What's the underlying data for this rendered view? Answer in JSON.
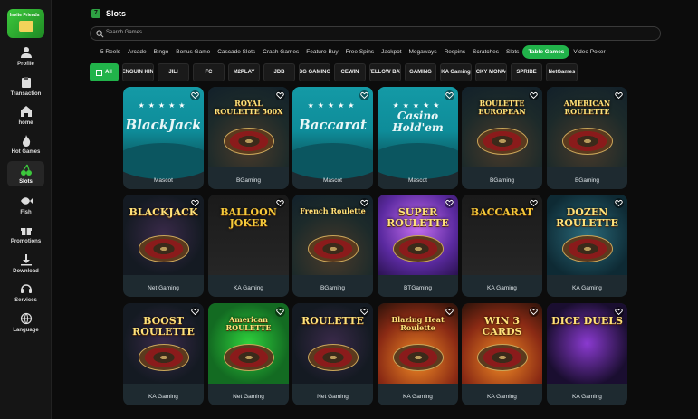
{
  "promo": {
    "label": "Invite Friends"
  },
  "sidebar": {
    "items": [
      {
        "label": "Profile",
        "icon": "user-icon"
      },
      {
        "label": "Transaction",
        "icon": "clipboard-icon"
      },
      {
        "label": "home",
        "icon": "home-icon"
      },
      {
        "label": "Hot Games",
        "icon": "flame-icon"
      },
      {
        "label": "Slots",
        "icon": "cherry-icon",
        "active": true
      },
      {
        "label": "Fish",
        "icon": "fish-icon"
      },
      {
        "label": "Promotions",
        "icon": "gift-icon"
      },
      {
        "label": "Download",
        "icon": "download-icon"
      },
      {
        "label": "Services",
        "icon": "headset-icon"
      },
      {
        "label": "Language",
        "icon": "globe-icon"
      }
    ]
  },
  "header": {
    "badge": "7",
    "title": "Slots"
  },
  "search": {
    "placeholder": "Search Games"
  },
  "categories": [
    "5 Reels",
    "Arcade",
    "Bingo",
    "Bonus Game",
    "Cascade Slots",
    "Crash Games",
    "Feature Buy",
    "Free Spins",
    "Jackpot",
    "Megaways",
    "Respins",
    "Scratches",
    "Slots",
    "Table Games",
    "Video Poker"
  ],
  "active_category": "Table Games",
  "providers": [
    "All",
    "PENGUIN KING",
    "JILI",
    "FC",
    "M2PLAY",
    "JDB",
    "BG GAMING",
    "CEWIN",
    "YELLOW BAT",
    "GAMING",
    "KA Gaming",
    "LUCKY MONACO",
    "SPRIBE",
    "NetGames"
  ],
  "games": [
    {
      "title": "BlackJack",
      "provider": "Mascot",
      "style": "teal"
    },
    {
      "title": "ROYAL ROULETTE 500X",
      "provider": "BGaming",
      "style": "roul"
    },
    {
      "title": "Baccarat",
      "provider": "Mascot",
      "style": "teal"
    },
    {
      "title": "Casino Hold'em",
      "provider": "Mascot",
      "style": "teal"
    },
    {
      "title": "ROULETTE EUROPEAN",
      "provider": "BGaming",
      "style": "roul"
    },
    {
      "title": "AMERICAN ROULETTE",
      "provider": "BGaming",
      "style": "roul"
    },
    {
      "title": "BLACKJACK",
      "provider": "Net Gaming",
      "style": "dark"
    },
    {
      "title": "BALLOON JOKER",
      "provider": "KA Gaming",
      "style": "cards-bg"
    },
    {
      "title": "French Roulette",
      "provider": "BGaming",
      "style": "roul"
    },
    {
      "title": "SUPER ROULETTE",
      "provider": "BTGaming",
      "style": "purple"
    },
    {
      "title": "BACCARAT",
      "provider": "KA Gaming",
      "style": "cards-bg"
    },
    {
      "title": "DOZEN ROULETTE",
      "provider": "KA Gaming",
      "style": "tealdark"
    },
    {
      "title": "BOOST ROULETTE",
      "provider": "KA Gaming",
      "style": "dark"
    },
    {
      "title": "American ROULETTE",
      "provider": "Net Gaming",
      "style": "green"
    },
    {
      "title": "ROULETTE",
      "provider": "Net Gaming",
      "style": "dark"
    },
    {
      "title": "Blazing Heat Roulette",
      "provider": "KA Gaming",
      "style": "fire"
    },
    {
      "title": "WIN 3 CARDS",
      "provider": "KA Gaming",
      "style": "fire"
    },
    {
      "title": "DICE DUELS",
      "provider": "KA Gaming",
      "style": "neon"
    }
  ]
}
